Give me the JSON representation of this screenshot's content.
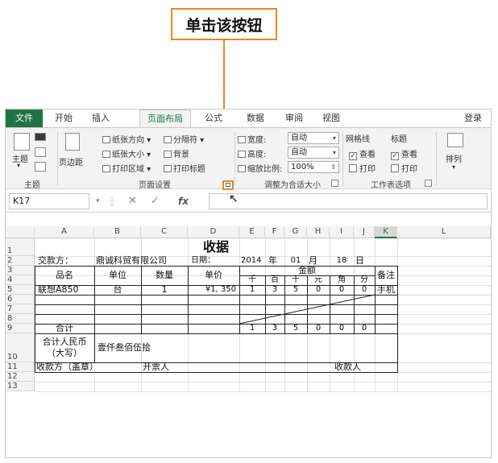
{
  "callout": {
    "text": "单击该按钮"
  },
  "tabs": [
    "文件",
    "开始",
    "插入",
    "页面布局",
    "公式",
    "数据",
    "审阅",
    "视图"
  ],
  "login": "登录",
  "ribbon": {
    "themes": {
      "btn": "主题",
      "group": "主题"
    },
    "margins": "页边距",
    "orientation": "纸张方向",
    "size": "纸张大小",
    "print_area": "打印区域",
    "breaks": "分隔符",
    "background": "背景",
    "print_titles": "打印标题",
    "page_setup_group": "页面设置",
    "width_label": "宽度:",
    "width_value": "自动",
    "height_label": "高度:",
    "height_value": "自动",
    "scale_label": "缩放比例:",
    "scale_value": "100%",
    "scale_group": "调整为合适大小",
    "gridlines": "网格线",
    "headings": "标题",
    "view_label": "查看",
    "print_label": "打印",
    "sheet_group": "工作表选项",
    "arrange": "排列"
  },
  "namebox": "K17",
  "fx_label": "fx",
  "columns": [
    "A",
    "B",
    "C",
    "D",
    "E",
    "F",
    "G",
    "H",
    "I",
    "J",
    "K",
    "L"
  ],
  "rows": [
    "1",
    "2",
    "3",
    "4",
    "5",
    "6",
    "7",
    "8",
    "9",
    "10",
    "11",
    "12",
    "13"
  ],
  "sheet": {
    "title": "收据",
    "payer_label": "交款方：",
    "payer": "鼎诚科贸有限公司",
    "date_label": "日期：",
    "year": "2014",
    "year_unit": "年",
    "month": "01",
    "month_unit": "月",
    "day": "18",
    "day_unit": "日",
    "h_name": "品名",
    "h_unit": "单位",
    "h_qty": "数量",
    "h_price": "单价",
    "h_amount": "金额",
    "h_remark": "备注",
    "digits": [
      "千",
      "百",
      "十",
      "元",
      "角",
      "分"
    ],
    "item": {
      "name": "联想A850",
      "unit": "台",
      "qty": "1",
      "price": "¥1, 350",
      "amount": [
        "1",
        "3",
        "5",
        "0",
        "0",
        "0"
      ],
      "remark": "手机"
    },
    "total_label": "合计",
    "total_amount": [
      "1",
      "3",
      "5",
      "0",
      "0",
      "0"
    ],
    "rmb_label_1": "合计人民币",
    "rmb_label_2": "（大写）",
    "rmb_value": "壹仟叁佰伍拾",
    "footer_payer": "收款方（盖章）",
    "footer_issuer": "开票人",
    "footer_receiver": "收款人"
  }
}
